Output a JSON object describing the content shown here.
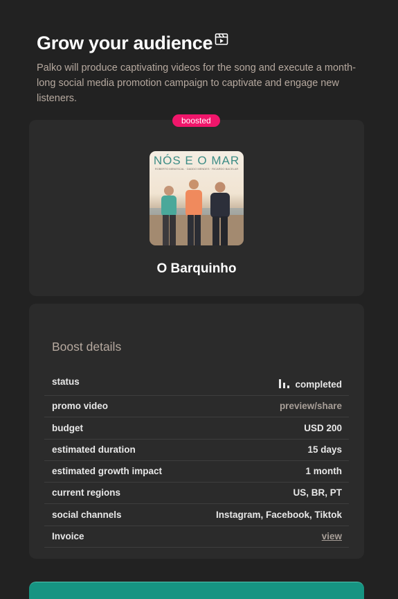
{
  "header": {
    "title": "Grow your audience",
    "title_icon": "clapperboard-icon",
    "description": "Palko will produce captivating videos for the song and execute a month-long social media promotion campaign to captivate and engage new listeners."
  },
  "song_card": {
    "badge": "boosted",
    "cover_title": "NÓS E O MAR",
    "cover_artists": "ROBERTO MENESCAL · DADDO MENDES · RICARDO BACELAR",
    "song_title": "O Barquinho"
  },
  "boost_details": {
    "heading": "Boost details",
    "rows": [
      {
        "label": "status",
        "value": "completed",
        "icon": "bar-chart-icon"
      },
      {
        "label": "promo video",
        "value": "preview/share"
      },
      {
        "label": "budget",
        "value": "USD 200"
      },
      {
        "label": "estimated duration",
        "value": "15 days"
      },
      {
        "label": "estimated growth impact",
        "value": "1 month"
      },
      {
        "label": "current regions",
        "value": "US, BR, PT"
      },
      {
        "label": "social channels",
        "value": "Instagram, Facebook, Tiktok"
      },
      {
        "label": "Invoice",
        "value": "view"
      }
    ]
  },
  "colors": {
    "background": "#222222",
    "card": "#2b2b2b",
    "accent_pink": "#f0166b",
    "muted_text": "#b6a99f",
    "cta_teal": "#169482"
  }
}
